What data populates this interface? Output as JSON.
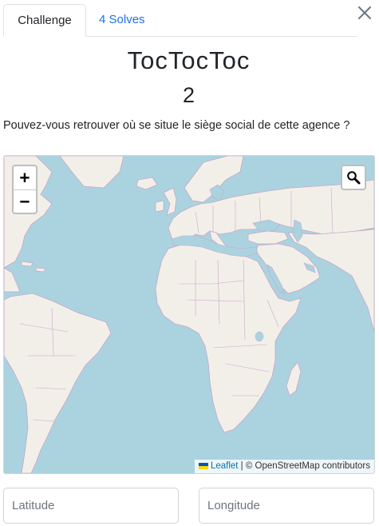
{
  "tabs": [
    {
      "label": "Challenge",
      "active": true
    },
    {
      "label": "4 Solves",
      "active": false
    }
  ],
  "challenge": {
    "title": "TocTocToc",
    "points": "2",
    "question": "Pouvez-vous retrouver où se situe le siège social de cette agence ?"
  },
  "map": {
    "zoom_in_label": "+",
    "zoom_out_label": "−",
    "attribution": {
      "leaflet_label": "Leaflet",
      "separator": " | © ",
      "osm_label": "OpenStreetMap contributors"
    },
    "colors": {
      "water": "#aad3df",
      "land": "#f2efe9",
      "border": "#c8a6c9"
    },
    "icons": {
      "search": "search-icon",
      "close": "close-icon"
    }
  },
  "inputs": {
    "latitude_placeholder": "Latitude",
    "longitude_placeholder": "Longitude"
  }
}
